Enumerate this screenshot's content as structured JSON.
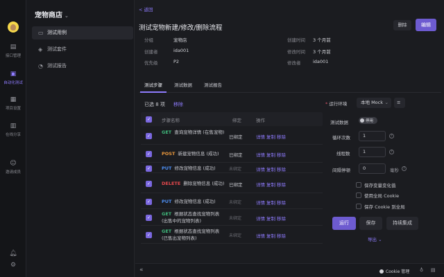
{
  "rail": {
    "items": [
      {
        "label": "接口管理",
        "icon": "api-icon"
      },
      {
        "label": "自动化测试",
        "icon": "automation-icon",
        "active": true
      },
      {
        "label": "项目设置",
        "icon": "settings-icon"
      },
      {
        "label": "在线分享",
        "icon": "share-icon"
      },
      {
        "label": "邀请成员",
        "icon": "invite-icon"
      }
    ]
  },
  "sidebar": {
    "store_name": "宠物商店",
    "items": [
      {
        "label": "测试用例",
        "active": true
      },
      {
        "label": "测试套件"
      },
      {
        "label": "测试报告"
      }
    ]
  },
  "header": {
    "back": "< 返回",
    "title": "测试宠物新建/修改/删除流程",
    "delete_label": "删除",
    "edit_label": "编辑"
  },
  "meta": {
    "group_key": "分组",
    "group_val": "宠物店",
    "created_time_key": "创建时间",
    "created_time_val": "3 个月前",
    "creator_key": "创建者",
    "creator_val": "ida001",
    "modified_time_key": "修改时间",
    "modified_time_val": "3 个月前",
    "priority_key": "优先级",
    "priority_val": "P2",
    "modifier_key": "修改者",
    "modifier_val": "ida001"
  },
  "tabs": [
    "测试步骤",
    "测试数据",
    "测试报告"
  ],
  "selection": {
    "info": "已选 8 项",
    "remove": "移除"
  },
  "table": {
    "headers": {
      "name": "步骤名称",
      "status": "绑定",
      "ops": "操作"
    },
    "ops": {
      "detail": "详情",
      "copy": "复制",
      "remove": "移除"
    },
    "rows": [
      {
        "method": "GET",
        "name": "查询宠物详情 (在售宠物)",
        "status": "已绑定"
      },
      {
        "method": "POST",
        "name": "新建宠物信息 (成功)",
        "status": "已绑定"
      },
      {
        "method": "PUT",
        "name": "修改宠物信息 (成功)",
        "status": "未绑定"
      },
      {
        "method": "DELETE",
        "name": "删除宠物信息 (成功)",
        "status": "已绑定"
      },
      {
        "method": "PUT",
        "name": "修改宠物信息 (成功)",
        "status": "未绑定"
      },
      {
        "method": "GET",
        "name": "根据状态查找宠物列表 (出售中的宠物列表)",
        "status": "未绑定"
      },
      {
        "method": "GET",
        "name": "根据状态查找宠物列表 (已售出宠物列表)",
        "status": "未绑定"
      }
    ]
  },
  "colors": {
    "GET": "#3fb67a",
    "POST": "#e8973c",
    "PUT": "#4c8df0",
    "DELETE": "#e5484d",
    "accent": "#7b68e0"
  },
  "run_panel": {
    "env_label": "运行环境",
    "env_value": "本地 Mock",
    "test_data_label": "测试数据",
    "test_data_toggle": "停用",
    "loops_label": "循环次数",
    "loops_value": "1",
    "threads_label": "线程数",
    "threads_value": "1",
    "interval_label": "间隔停顿",
    "interval_value": "0",
    "interval_unit": "毫秒",
    "checks": [
      "保存变量变化值",
      "使用全局 Cookie",
      "保存 Cookie 到全局"
    ],
    "run_label": "运行",
    "save_label": "保存",
    "ci_label": "持续集成",
    "export_label": "导出"
  },
  "footer": {
    "cookie_label": "Cookie 管理"
  }
}
